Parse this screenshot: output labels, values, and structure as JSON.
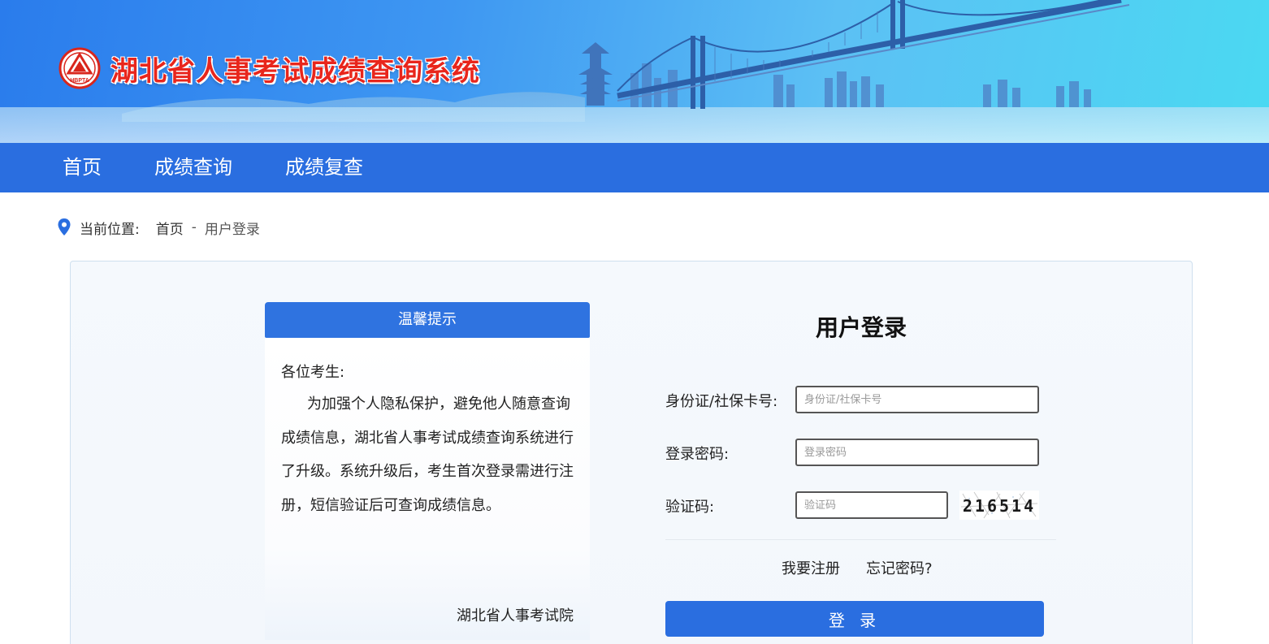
{
  "header": {
    "site_title": "湖北省人事考试成绩查询系统",
    "logo_icon": "hbpta-logo-icon",
    "logo_text": "HBPTA",
    "brand_red": "#e8261c"
  },
  "nav": {
    "items": [
      {
        "label": "首页"
      },
      {
        "label": "成绩查询"
      },
      {
        "label": "成绩复查"
      }
    ],
    "color": "#2a6ee0"
  },
  "breadcrumb": {
    "icon": "location-pin-icon",
    "prefix": "当前位置:",
    "home": "首页",
    "separator": "-",
    "current": "用户登录"
  },
  "notice": {
    "title": "温馨提示",
    "greeting": "各位考生:",
    "body": "为加强个人隐私保护，避免他人随意查询成绩信息，湖北省人事考试成绩查询系统进行了升级。系统升级后，考生首次登录需进行注册，短信验证后可查询成绩信息。",
    "signature": "湖北省人事考试院"
  },
  "login": {
    "title": "用户登录",
    "id_label": "身份证/社保卡号:",
    "id_placeholder": "身份证/社保卡号",
    "password_label": "登录密码:",
    "password_placeholder": "登录密码",
    "captcha_label": "验证码:",
    "captcha_placeholder": "验证码",
    "captcha_value": "216514",
    "register_link": "我要注册",
    "forgot_link": "忘记密码?",
    "submit_label": "登 录"
  }
}
